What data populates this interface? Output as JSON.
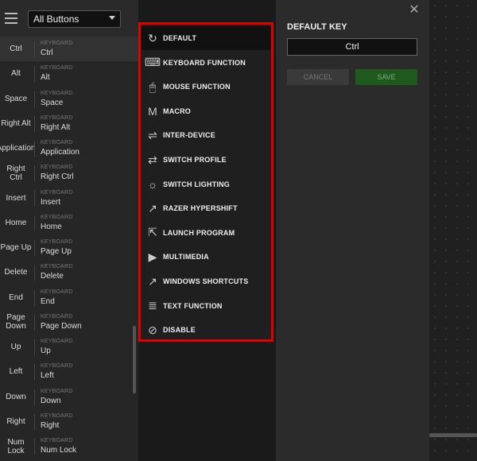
{
  "left_panel": {
    "filter": "All Buttons",
    "keys": [
      {
        "name": "Ctrl",
        "type": "KEYBOARD",
        "value": "Ctrl"
      },
      {
        "name": "Alt",
        "type": "KEYBOARD",
        "value": "Alt"
      },
      {
        "name": "Space",
        "type": "KEYBOARD",
        "value": "Space"
      },
      {
        "name": "Right Alt",
        "type": "KEYBOARD",
        "value": "Right Alt"
      },
      {
        "name": "Application",
        "type": "KEYBOARD",
        "value": "Application"
      },
      {
        "name": "Right Ctrl",
        "type": "KEYBOARD",
        "value": "Right Ctrl"
      },
      {
        "name": "Insert",
        "type": "KEYBOARD",
        "value": "Insert"
      },
      {
        "name": "Home",
        "type": "KEYBOARD",
        "value": "Home"
      },
      {
        "name": "Page Up",
        "type": "KEYBOARD",
        "value": "Page Up"
      },
      {
        "name": "Delete",
        "type": "KEYBOARD",
        "value": "Delete"
      },
      {
        "name": "End",
        "type": "KEYBOARD",
        "value": "End"
      },
      {
        "name": "Page Down",
        "type": "KEYBOARD",
        "value": "Page Down"
      },
      {
        "name": "Up",
        "type": "KEYBOARD",
        "value": "Up"
      },
      {
        "name": "Left",
        "type": "KEYBOARD",
        "value": "Left"
      },
      {
        "name": "Down",
        "type": "KEYBOARD",
        "value": "Down"
      },
      {
        "name": "Right",
        "type": "KEYBOARD",
        "value": "Right"
      },
      {
        "name": "Num Lock",
        "type": "KEYBOARD",
        "value": "Num Lock"
      }
    ]
  },
  "menu": {
    "items": [
      {
        "label": "DEFAULT",
        "icon": "refresh-icon",
        "glyph": "↻"
      },
      {
        "label": "KEYBOARD FUNCTION",
        "icon": "keyboard-icon",
        "glyph": "⌨"
      },
      {
        "label": "MOUSE FUNCTION",
        "icon": "mouse-icon",
        "glyph": "🖱"
      },
      {
        "label": "MACRO",
        "icon": "macro-icon",
        "glyph": "M"
      },
      {
        "label": "INTER-DEVICE",
        "icon": "inter-device-icon",
        "glyph": "⇌"
      },
      {
        "label": "SWITCH PROFILE",
        "icon": "switch-profile-icon",
        "glyph": "⇄"
      },
      {
        "label": "SWITCH LIGHTING",
        "icon": "lighting-icon",
        "glyph": "☼"
      },
      {
        "label": "RAZER HYPERSHIFT",
        "icon": "hypershift-icon",
        "glyph": "↗"
      },
      {
        "label": "LAUNCH PROGRAM",
        "icon": "launch-program-icon",
        "glyph": "⇱"
      },
      {
        "label": "MULTIMEDIA",
        "icon": "multimedia-icon",
        "glyph": "▶"
      },
      {
        "label": "WINDOWS SHORTCUTS",
        "icon": "shortcut-icon",
        "glyph": "↗"
      },
      {
        "label": "TEXT FUNCTION",
        "icon": "text-icon",
        "glyph": "≣"
      },
      {
        "label": "DISABLE",
        "icon": "disable-icon",
        "glyph": "⊘"
      }
    ]
  },
  "detail": {
    "close_glyph": "✕",
    "title": "DEFAULT KEY",
    "key_value": "Ctrl",
    "cancel_label": "CANCEL",
    "save_label": "SAVE"
  },
  "colors": {
    "highlight_border": "#e00000",
    "save_green": "#1e5a1e"
  }
}
